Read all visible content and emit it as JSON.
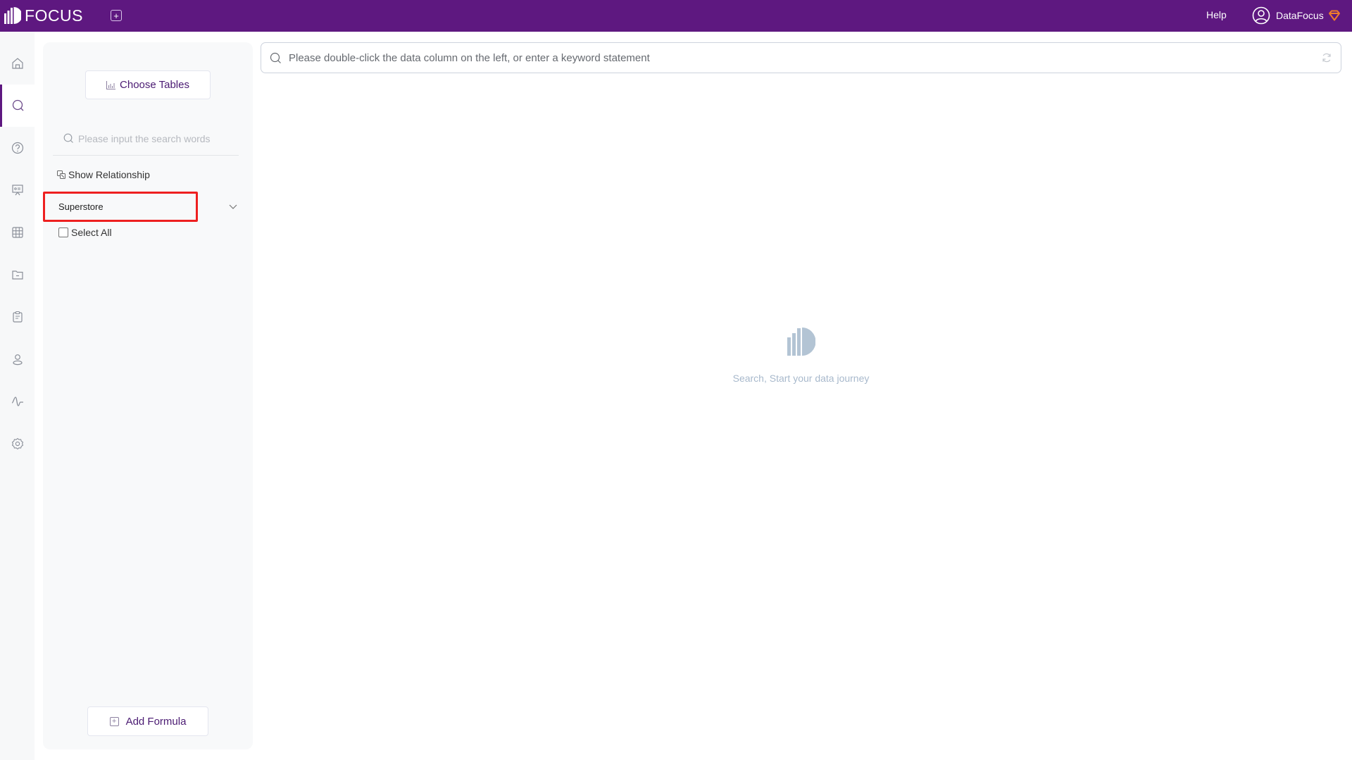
{
  "topbar": {
    "brand": "FOCUS",
    "new_tab_icon": "plus-square-icon",
    "help_label": "Help",
    "user_name": "DataFocus",
    "vip_icon": "diamond-icon",
    "colors": {
      "bar": "#5e1880",
      "vip": "#f07c2a"
    }
  },
  "leftnav": {
    "items": [
      {
        "name": "home",
        "icon": "home-icon",
        "active": false
      },
      {
        "name": "search",
        "icon": "search-icon",
        "active": true
      },
      {
        "name": "question",
        "icon": "question-circle-icon",
        "active": false
      },
      {
        "name": "presentation",
        "icon": "presentation-board-icon",
        "active": false
      },
      {
        "name": "tables",
        "icon": "grid-table-icon",
        "active": false
      },
      {
        "name": "folder",
        "icon": "folder-icon",
        "active": false
      },
      {
        "name": "clipboard",
        "icon": "clipboard-icon",
        "active": false
      },
      {
        "name": "user",
        "icon": "user-icon",
        "active": false
      },
      {
        "name": "activity",
        "icon": "pulse-icon",
        "active": false
      },
      {
        "name": "settings",
        "icon": "gear-icon",
        "active": false
      }
    ]
  },
  "panel": {
    "choose_tables_label": "Choose Tables",
    "search_placeholder": "Please input the search words",
    "show_relationship_label": "Show Relationship",
    "tables": [
      {
        "name": "Superstore",
        "expanded": false
      }
    ],
    "select_all_label": "Select All",
    "select_all_checked": false,
    "add_formula_label": "Add Formula"
  },
  "main": {
    "search_placeholder": "Please double-click the data column on the left, or enter a keyword statement",
    "search_value": "",
    "empty_state_text": "Search, Start your data journey"
  }
}
